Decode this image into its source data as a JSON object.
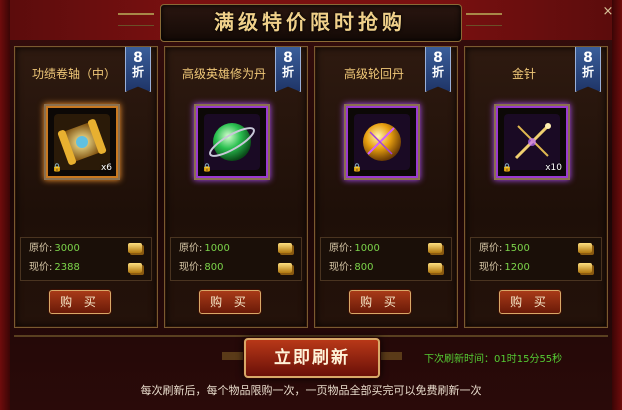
{
  "header": {
    "title": "满级特价限时抢购",
    "close_icon": "×"
  },
  "labels": {
    "original": "原价:",
    "current": "现价:"
  },
  "colors": {
    "orange_border": "#ff9a30",
    "purple_border": "#b050ff",
    "value_green": "#7bd34a"
  },
  "items": [
    {
      "name": "功绩卷轴（中）",
      "discount_number": "8",
      "discount_char": "折",
      "original_price": "3000",
      "current_price": "2388",
      "quantity": "x6",
      "rarity": "orange",
      "icon": "scroll-icon",
      "buy_label": "购 买"
    },
    {
      "name": "高级英雄修为丹",
      "discount_number": "8",
      "discount_char": "折",
      "original_price": "1000",
      "current_price": "800",
      "quantity": "",
      "rarity": "purple",
      "icon": "green-orb-icon",
      "buy_label": "购 买"
    },
    {
      "name": "高级轮回丹",
      "discount_number": "8",
      "discount_char": "折",
      "original_price": "1000",
      "current_price": "800",
      "quantity": "",
      "rarity": "purple",
      "icon": "golden-orb-icon",
      "buy_label": "购 买"
    },
    {
      "name": "金针",
      "discount_number": "8",
      "discount_char": "折",
      "original_price": "1500",
      "current_price": "1200",
      "quantity": "x10",
      "rarity": "purple",
      "icon": "golden-needle-icon",
      "buy_label": "购 买"
    }
  ],
  "footer": {
    "refresh_label": "立即刷新",
    "timer_text": "下次刷新时间：01时15分55秒",
    "note": "每次刷新后，每个物品限购一次，一页物品全部买完可以免费刷新一次"
  }
}
